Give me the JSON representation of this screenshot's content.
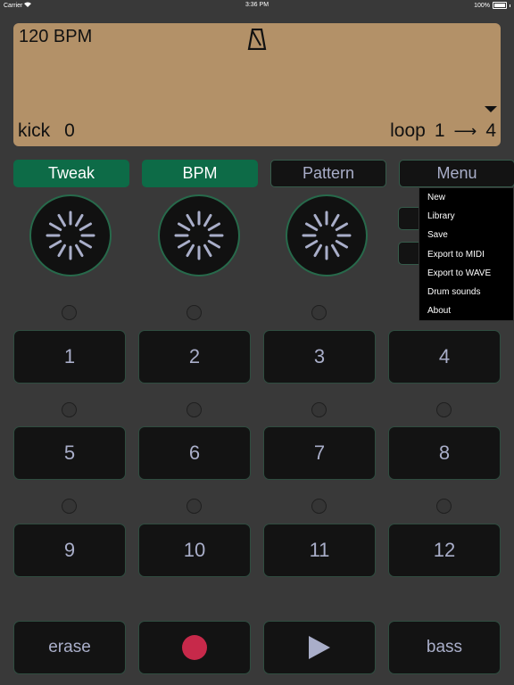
{
  "status_bar": {
    "carrier": "Carrier",
    "time": "3:36 PM",
    "battery": "100%"
  },
  "display": {
    "bpm": "120 BPM",
    "track_name": "kick",
    "track_value": "0",
    "loop_label": "loop",
    "loop_start": "1",
    "loop_arrow": "⟶",
    "loop_end": "4",
    "background_color": "#b39168"
  },
  "top_buttons": [
    {
      "label": "Tweak",
      "active": true
    },
    {
      "label": "BPM",
      "active": true
    },
    {
      "label": "Pattern",
      "active": false
    },
    {
      "label": "Menu",
      "active": false
    }
  ],
  "menu": {
    "items": [
      "New",
      "Library",
      "Save",
      "Export to MIDI",
      "Export to WAVE",
      "Drum sounds",
      "About"
    ]
  },
  "pads": [
    "1",
    "2",
    "3",
    "4",
    "5",
    "6",
    "7",
    "8",
    "9",
    "10",
    "11",
    "12"
  ],
  "bottom_controls": {
    "erase": "erase",
    "record_icon": "record-icon",
    "play_icon": "play-icon",
    "bass": "bass"
  },
  "colors": {
    "accent_green": "#0d6b47",
    "record_red": "#c7294a",
    "pad_text": "#a9aec9"
  }
}
